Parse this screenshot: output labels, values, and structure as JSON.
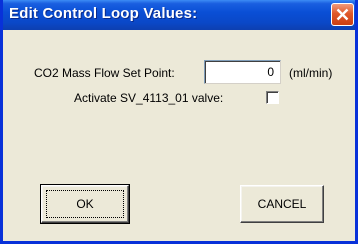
{
  "window": {
    "title": "Edit Control Loop Values:"
  },
  "form": {
    "setpoint_label": "CO2 Mass Flow Set Point:",
    "setpoint_value": "0",
    "setpoint_unit": "(ml/min)",
    "valve_label": "Activate SV_4113_01 valve:",
    "valve_checked": false
  },
  "buttons": {
    "ok_label": "OK",
    "cancel_label": "CANCEL"
  },
  "icons": {
    "close": "close-icon"
  },
  "colors": {
    "titlebar": "#0a4fd6",
    "close_button": "#e0582a",
    "dialog_background": "#ece9d8"
  }
}
